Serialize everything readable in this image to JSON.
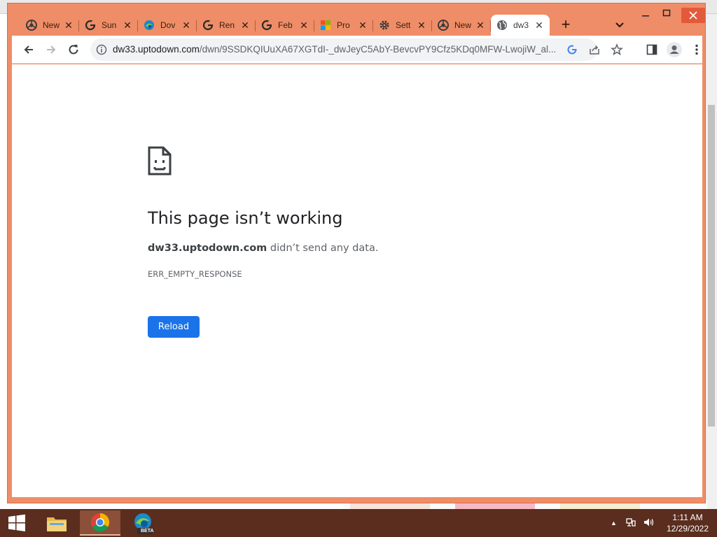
{
  "browser": {
    "tabs": [
      {
        "title": "New",
        "icon": "chrome-icon"
      },
      {
        "title": "Sun",
        "icon": "google-icon"
      },
      {
        "title": "Dov",
        "icon": "edge-icon"
      },
      {
        "title": "Ren",
        "icon": "google-icon"
      },
      {
        "title": "Feb",
        "icon": "google-icon"
      },
      {
        "title": "Pro",
        "icon": "microsoft-icon"
      },
      {
        "title": "Sett",
        "icon": "settings-icon"
      },
      {
        "title": "New",
        "icon": "chrome-icon"
      },
      {
        "title": "dw3",
        "icon": "globe-icon",
        "active": true
      }
    ],
    "url_host": "dw33.uptodown.com",
    "url_path": "/dwn/9SSDKQIUuXA67XGTdI-_dwJeyC5AbY-BevcvPY9Cfz5KDq0MFW-LwojiW_al..."
  },
  "error": {
    "title": "This page isn’t working",
    "host": "dw33.uptodown.com",
    "message": " didn’t send any data.",
    "code": "ERR_EMPTY_RESPONSE",
    "reload_label": "Reload"
  },
  "taskbar": {
    "time": "1:11 AM",
    "date": "12/29/2022",
    "beta_label": "BETA"
  },
  "colors": {
    "frame": "#ee8d67",
    "accent_blue": "#1a73e8",
    "taskbar": "#5a2d1e"
  }
}
